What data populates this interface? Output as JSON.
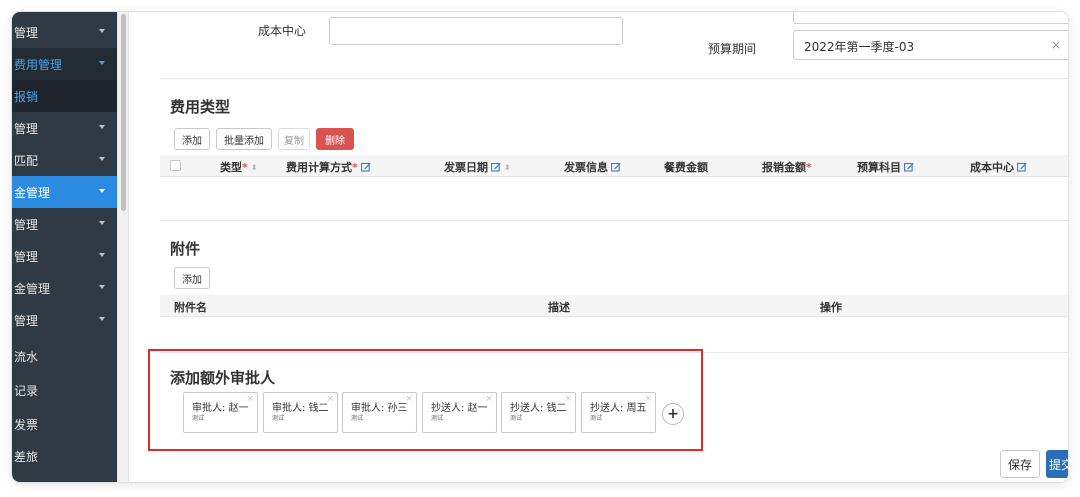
{
  "sidebar": {
    "items": [
      {
        "label": "管理",
        "chevron": true,
        "state": "normal"
      },
      {
        "label": "费用管理",
        "chevron": true,
        "state": "sub"
      },
      {
        "label": "报销",
        "chevron": false,
        "state": "subitem"
      },
      {
        "label": "管理",
        "chevron": true,
        "state": "normal"
      },
      {
        "label": "匹配",
        "chevron": true,
        "state": "normal"
      },
      {
        "label": "金管理",
        "chevron": true,
        "state": "active"
      },
      {
        "label": "管理",
        "chevron": true,
        "state": "normal"
      },
      {
        "label": "管理",
        "chevron": true,
        "state": "normal"
      },
      {
        "label": "金管理",
        "chevron": true,
        "state": "normal"
      },
      {
        "label": "管理",
        "chevron": true,
        "state": "normal"
      },
      {
        "label": "流水",
        "chevron": false,
        "state": "normal"
      },
      {
        "label": "记录",
        "chevron": false,
        "state": "normal"
      },
      {
        "label": "发票",
        "chevron": false,
        "state": "normal"
      },
      {
        "label": "差旅",
        "chevron": false,
        "state": "normal"
      }
    ]
  },
  "form": {
    "cost_center_label": "成本中心",
    "cost_center_value": "",
    "budget_period_label": "预算期间",
    "budget_period_value": "2022年第一季度-03",
    "select_clear": "×",
    "select_arrow": "▾"
  },
  "expense": {
    "title": "费用类型",
    "buttons": {
      "add": "添加",
      "bulk_add": "批量添加",
      "copy": "复制",
      "delete": "删除"
    },
    "columns": [
      {
        "label": "类型",
        "required": "*",
        "sortable": true,
        "editable": false
      },
      {
        "label": "费用计算方式",
        "required": "*",
        "sortable": false,
        "editable": true
      },
      {
        "label": "发票日期",
        "required": "",
        "sortable": true,
        "editable": true
      },
      {
        "label": "发票信息",
        "required": "",
        "sortable": false,
        "editable": true
      },
      {
        "label": "餐费金额",
        "required": "",
        "sortable": false,
        "editable": false
      },
      {
        "label": "报销金额",
        "required": "*",
        "sortable": false,
        "editable": false
      },
      {
        "label": "预算科目",
        "required": "",
        "sortable": false,
        "editable": true
      },
      {
        "label": "成本中心",
        "required": "",
        "sortable": false,
        "editable": true
      }
    ]
  },
  "attachments": {
    "title": "附件",
    "add_label": "添加",
    "columns": [
      "附件名",
      "描述",
      "操作"
    ]
  },
  "approvers": {
    "title": "添加额外审批人",
    "tags": [
      {
        "label": "审批人: 赵一",
        "sub": "测试"
      },
      {
        "label": "审批人: 钱二",
        "sub": "测试"
      },
      {
        "label": "审批人: 孙三",
        "sub": "测试"
      },
      {
        "label": "抄送人: 赵一",
        "sub": "测试"
      },
      {
        "label": "抄送人: 钱二",
        "sub": "测试"
      },
      {
        "label": "抄送人: 周五",
        "sub": "测试"
      }
    ],
    "remove_glyph": "×",
    "add_glyph": "+"
  },
  "actions": {
    "save": "保存",
    "submit": "提交"
  },
  "colors": {
    "sidebar": "#2f3a44",
    "active": "#2a8be0",
    "danger": "#d9534f",
    "highlight": "#e02b2b",
    "primary": "#2a6fb5"
  }
}
